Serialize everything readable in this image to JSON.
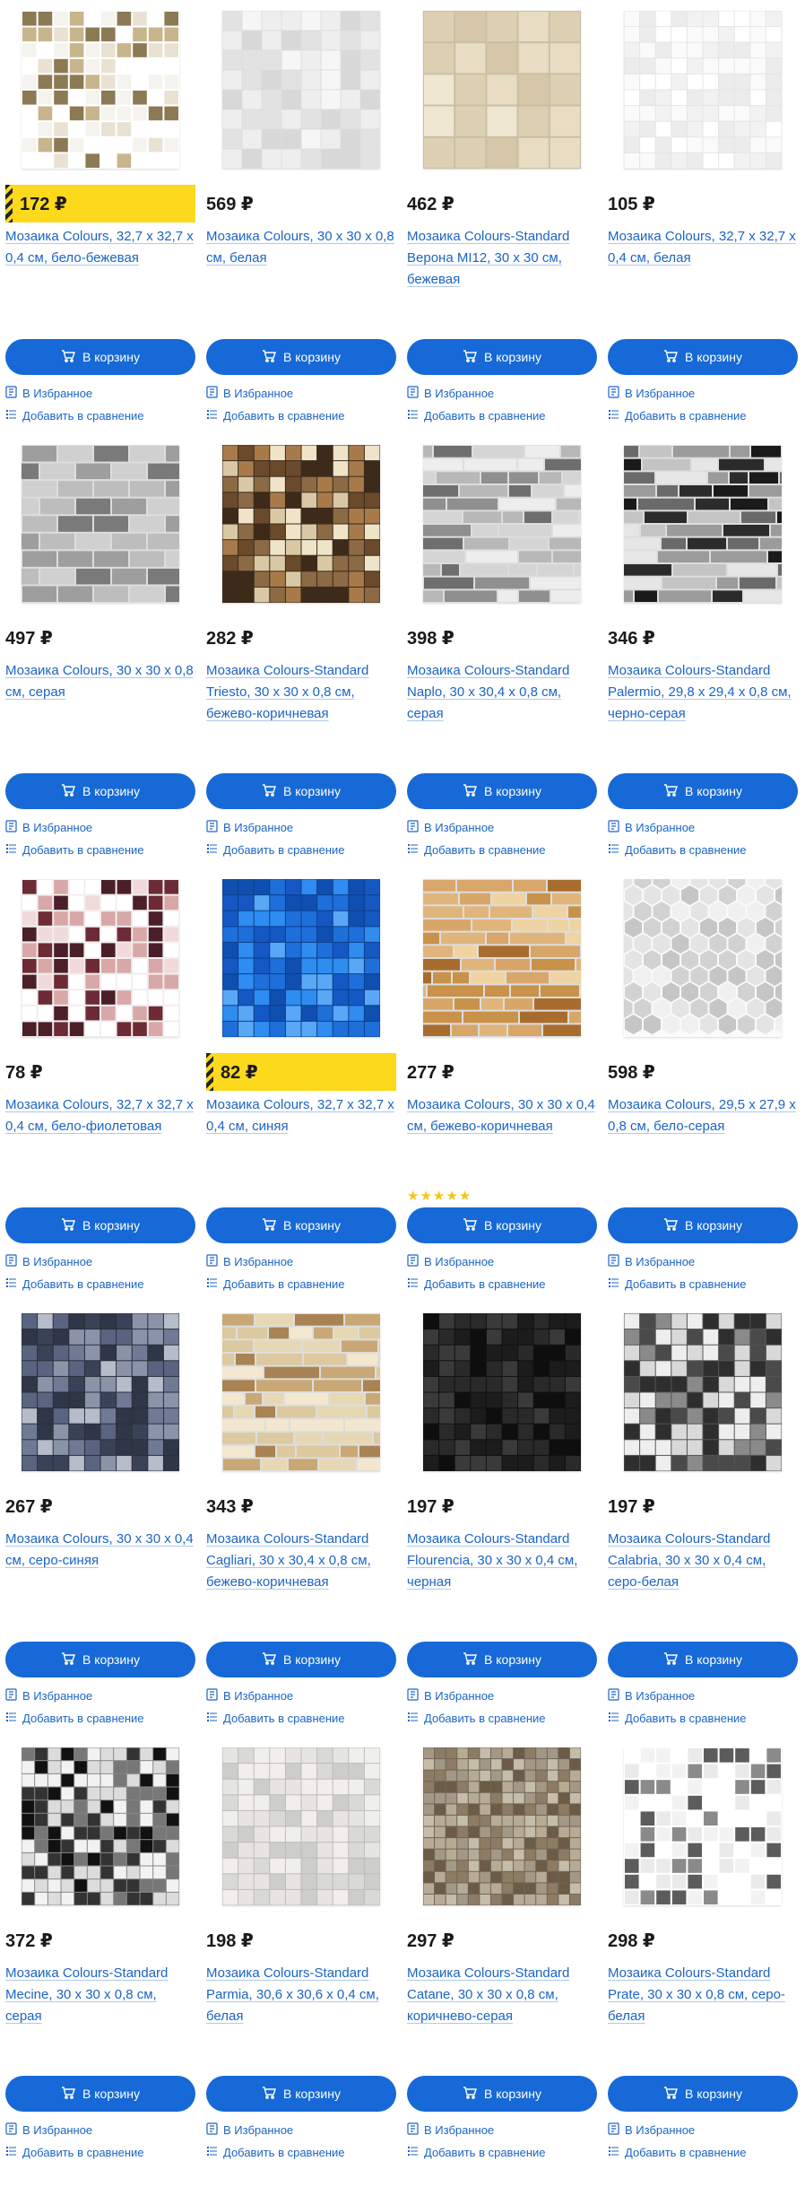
{
  "ui": {
    "cart_label": "В корзину",
    "favorite_label": "В Избранное",
    "compare_label": "Добавить в сравнение",
    "colors": {
      "accent": "#1669d6",
      "link": "#1b64c5",
      "promo": "#fcd91c",
      "star": "#f5c518"
    }
  },
  "products": [
    {
      "price": "172 ₽",
      "promo": true,
      "title": "Мозаика Colours, 32,7 x 32,7 x 0,4 см, бело-бежевая",
      "rating": 0,
      "pattern": "beige-white"
    },
    {
      "price": "569 ₽",
      "promo": false,
      "title": "Мозаика Colours, 30 x 30 x 0,8 см, белая",
      "rating": 0,
      "pattern": "white-stone"
    },
    {
      "price": "462 ₽",
      "promo": false,
      "title": "Мозаика Colours-Standard Верона MI12, 30 x 30 см, бежевая",
      "rating": 0,
      "pattern": "beige-squares"
    },
    {
      "price": "105 ₽",
      "promo": false,
      "title": "Мозаика Colours, 32,7 x 32,7 x 0,4 см, белая",
      "rating": 0,
      "pattern": "white"
    },
    {
      "price": "497 ₽",
      "promo": false,
      "title": "Мозаика Colours, 30 x 30 x 0,8 см, серая",
      "rating": 0,
      "pattern": "grey-brick"
    },
    {
      "price": "282 ₽",
      "promo": false,
      "title": "Мозаика Colours-Standard Triesto, 30 x 30 x 0,8 см, бежево-коричневая",
      "rating": 0,
      "pattern": "brown-beige"
    },
    {
      "price": "398 ₽",
      "promo": false,
      "title": "Мозаика Colours-Standard Naplo, 30 x 30,4 x 0,8 см, серая",
      "rating": 0,
      "pattern": "grey-strips"
    },
    {
      "price": "346 ₽",
      "promo": false,
      "title": "Мозаика Colours-Standard Palermio, 29,8 x 29,4 x 0,8 см, черно-серая",
      "rating": 0,
      "pattern": "black-strips"
    },
    {
      "price": "78 ₽",
      "promo": false,
      "title": "Мозаика Colours, 32,7 x 32,7 x 0,4 см, бело-фиолетовая",
      "rating": 0,
      "pattern": "violet-white"
    },
    {
      "price": "82 ₽",
      "promo": true,
      "title": "Мозаика Colours, 32,7 x 32,7 x 0,4 см, синяя",
      "rating": 0,
      "pattern": "blue"
    },
    {
      "price": "277 ₽",
      "promo": false,
      "title": "Мозаика Colours, 30 x 30 x 0,4 см, бежево-коричневая",
      "rating": 5,
      "pattern": "amber"
    },
    {
      "price": "598 ₽",
      "promo": false,
      "title": "Мозаика Colours, 29,5 x 27,9 x 0,8 см, бело-серая",
      "rating": 0,
      "pattern": "hexagon"
    },
    {
      "price": "267 ₽",
      "promo": false,
      "title": "Мозаика Colours, 30 x 30 x 0,4 см, серо-синяя",
      "rating": 0,
      "pattern": "grey-blue"
    },
    {
      "price": "343 ₽",
      "promo": false,
      "title": "Мозаика Colours-Standard Cagliari, 30 x 30,4 x 0,8 см, бежево-коричневая",
      "rating": 0,
      "pattern": "beige-strips"
    },
    {
      "price": "197 ₽",
      "promo": false,
      "title": "Мозаика Colours-Standard Flourencia, 30 x 30 x 0,4 см, черная",
      "rating": 0,
      "pattern": "black"
    },
    {
      "price": "197 ₽",
      "promo": false,
      "title": "Мозаика Colours-Standard Calabria, 30 x 30 x 0,4 см, серо-белая",
      "rating": 0,
      "pattern": "grey-white-check"
    },
    {
      "price": "372 ₽",
      "promo": false,
      "title": "Мозаика Colours-Standard Mecine, 30 x 30 x 0,8 см, серая",
      "rating": 0,
      "pattern": "black-white-check"
    },
    {
      "price": "198 ₽",
      "promo": false,
      "title": "Мозаика Colours-Standard Parmia, 30,6 x 30,6 x 0,4 см, белая",
      "rating": 0,
      "pattern": "pale-grey"
    },
    {
      "price": "297 ₽",
      "promo": false,
      "title": "Мозаика Colours-Standard Catane, 30 x 30 x 0,8 см, коричнево-серая",
      "rating": 0,
      "pattern": "brown-grey-small"
    },
    {
      "price": "298 ₽",
      "promo": false,
      "title": "Мозаика Colours-Standard Prate, 30 x 30 x 0,8 см, серо-белая",
      "rating": 0,
      "pattern": "white-grey-sparse"
    }
  ]
}
